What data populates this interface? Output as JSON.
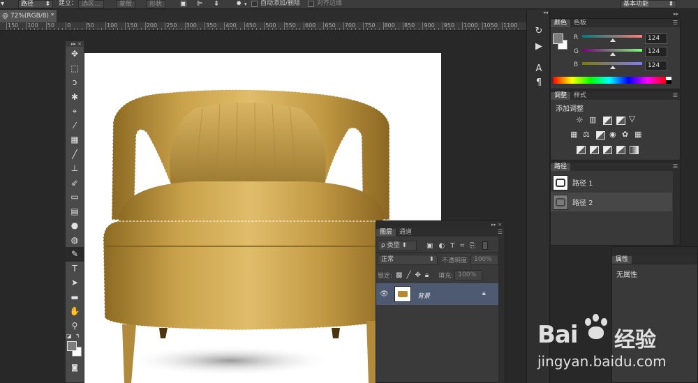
{
  "options_bar": {
    "mode_label": "路径",
    "build_label": "建立：",
    "selection_btn": "选区...",
    "mask_btn": "蒙版",
    "shape_btn": "形状",
    "auto_add_label": "自动添加/删除",
    "align_edges_label": "对齐边缘",
    "workspace_label": "基本功能"
  },
  "document": {
    "tab_title": "@ 72%(RGB/8) *"
  },
  "ruler": {
    "labels": [
      "150",
      "100",
      "50",
      "0",
      "50",
      "100",
      "150",
      "200",
      "250",
      "300",
      "350",
      "400",
      "450",
      "500",
      "550",
      "600",
      "650",
      "700",
      "750",
      "800",
      "850",
      "900",
      "950",
      "1000",
      "1050",
      "1100"
    ]
  },
  "color_panel": {
    "tab_color": "颜色",
    "tab_swatches": "色板",
    "r_label": "R",
    "g_label": "G",
    "b_label": "B",
    "r_value": "124",
    "g_value": "124",
    "b_value": "124",
    "fg_color": "#7c7c7c"
  },
  "adjustments_panel": {
    "tab_adjust": "调整",
    "tab_styles": "样式",
    "add_adjustment_label": "添加调整"
  },
  "paths_panel": {
    "tab_paths": "路径",
    "items": [
      "路径 1",
      "路径 2"
    ]
  },
  "layers_panel": {
    "tab_layers": "图层",
    "tab_channels": "通道",
    "filter_label": "ρ 类型",
    "blend_mode": "正常",
    "opacity_label": "不透明度:",
    "opacity_value": "100%",
    "lock_label": "锁定:",
    "fill_label": "填充:",
    "fill_value": "100%",
    "layer_name": "背景"
  },
  "properties_panel": {
    "tab_properties": "属性",
    "no_properties": "无属性"
  },
  "watermark": {
    "logo_left": "Bai",
    "logo_right": "经验",
    "url": "jingyan.baidu.com"
  }
}
